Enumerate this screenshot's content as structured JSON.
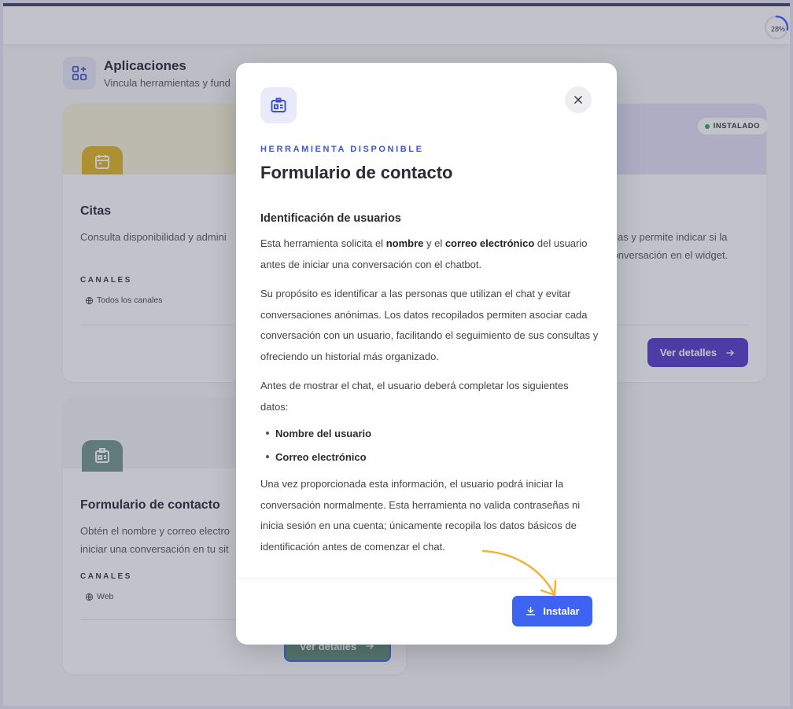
{
  "header": {
    "progress_label": "28%",
    "progress": 0.28
  },
  "section": {
    "title": "Aplicaciones",
    "subtitle": "Vincula herramientas y fund"
  },
  "cards": {
    "citas": {
      "title": "Citas",
      "description": "Consulta disponibilidad y admini",
      "channels_label": "CANALES",
      "channel": "Todos los canales",
      "banner_color": "#f6f1d6",
      "icon_color": "#e0b31c"
    },
    "installed": {
      "badge": "INSTALADO",
      "description_line1": "ellas y permite indicar si la",
      "description_line2": "conversación en el widget.",
      "details_button": "Ver detalles",
      "button_color": "#5236c9"
    },
    "contact": {
      "title": "Formulario de contacto",
      "description_line1": "Obtén el nombre y correo electro",
      "description_line2": "iniciar una conversación en tu sit",
      "channels_label": "CANALES",
      "channel": "Web",
      "details_button": "Ver detalles",
      "icon_color": "#6f9488",
      "button_color": "#5e8c78"
    }
  },
  "modal": {
    "eyebrow": "HERRAMIENTA DISPONIBLE",
    "title": "Formulario de contacto",
    "section_heading": "Identificación de usuarios",
    "p1": {
      "before": "Esta herramienta solicita el ",
      "bold1": "nombre",
      "middle": " y el ",
      "bold2": "correo electrónico",
      "after": " del usuario antes de iniciar una conversación con el chatbot."
    },
    "p2": "Su propósito es identificar a las personas que utilizan el chat y evitar conversaciones anónimas. Los datos recopilados permiten asociar cada conversación con un usuario, facilitando el seguimiento de sus consultas y ofreciendo un historial más organizado.",
    "p3": "Antes de mostrar el chat, el usuario deberá completar los siguientes datos:",
    "bullets": [
      "Nombre del usuario",
      "Correo electrónico"
    ],
    "p4": "Una vez proporcionada esta información, el usuario podrá iniciar la conversación normalmente. Esta herramienta no valida contraseñas ni inicia sesión en una cuenta; únicamente recopila los datos básicos de identificación antes de comenzar el chat.",
    "install_button": "Instalar",
    "accent": "#3e63f0",
    "arrow_color": "#efb43a"
  }
}
